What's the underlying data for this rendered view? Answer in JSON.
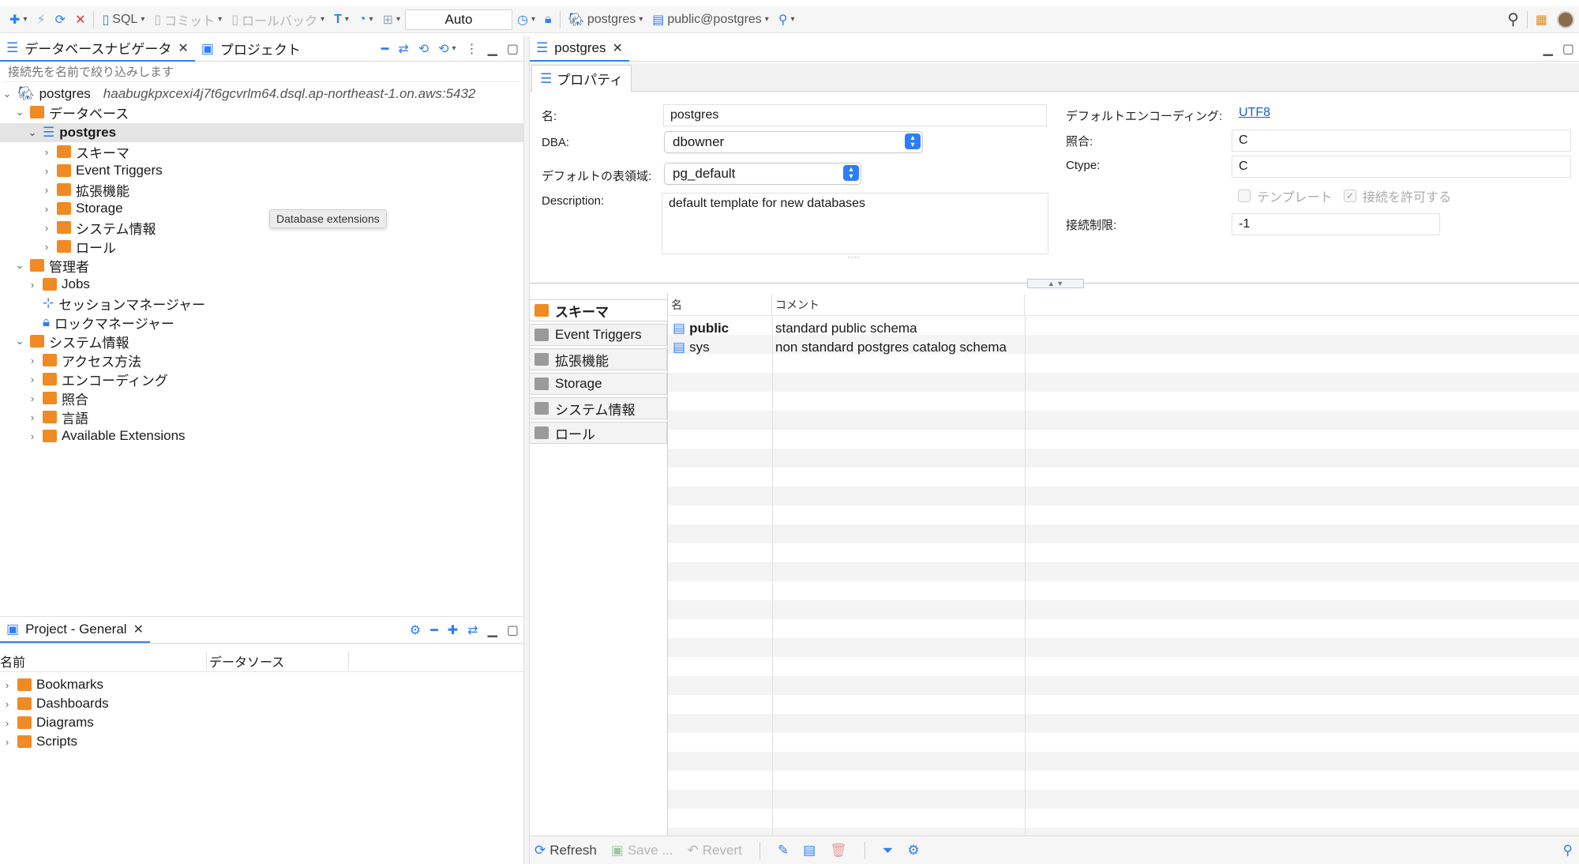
{
  "toolbar": {
    "sql_label": "SQL",
    "commit_label": "コミット",
    "rollback_label": "ロールバック",
    "mode_value": "Auto",
    "db_label": "postgres",
    "schema_label": "public@postgres"
  },
  "navigator": {
    "tab_db": "データベースナビゲータ",
    "tab_project": "プロジェクト",
    "filter_placeholder": "接続先を名前で絞り込みします",
    "conn_name": "postgres",
    "conn_host": "haabugkpxcexi4j7t6gcvrlm64.dsql.ap-northeast-1.on.aws:5432",
    "items": {
      "databases": "データベース",
      "db_postgres": "postgres",
      "schema": "スキーマ",
      "event_triggers": "Event Triggers",
      "extensions": "拡張機能",
      "storage": "Storage",
      "sysinfo": "システム情報",
      "roles": "ロール",
      "admin": "管理者",
      "jobs": "Jobs",
      "session_mgr": "セッションマネージャー",
      "lock_mgr": "ロックマネージャー",
      "sysinfo2": "システム情報",
      "access_methods": "アクセス方法",
      "encodings": "エンコーディング",
      "collations": "照合",
      "languages": "言語",
      "available_ext": "Available Extensions"
    },
    "tooltip": "Database extensions"
  },
  "project": {
    "title": "Project - General",
    "col_name": "名前",
    "col_ds": "データソース",
    "items": [
      "Bookmarks",
      "Dashboards",
      "Diagrams",
      "Scripts"
    ]
  },
  "editor": {
    "tab_title": "postgres",
    "subtab": "プロパティ",
    "props": {
      "name_label": "名:",
      "name_value": "postgres",
      "dba_label": "DBA:",
      "dba_value": "dbowner",
      "tablespace_label": "デフォルトの表領域:",
      "tablespace_value": "pg_default",
      "desc_label": "Description:",
      "desc_value": "default template for new databases",
      "enc_label": "デフォルトエンコーディング:",
      "enc_value": "UTF8",
      "collate_label": "照合:",
      "collate_value": "C",
      "ctype_label": "Ctype:",
      "ctype_value": "C",
      "template_label": "テンプレート",
      "allow_conn_label": "接続を許可する",
      "conn_limit_label": "接続制限:",
      "conn_limit_value": "-1"
    },
    "side_tabs": [
      "スキーマ",
      "Event Triggers",
      "拡張機能",
      "Storage",
      "システム情報",
      "ロール"
    ],
    "table": {
      "col_name": "名",
      "col_comment": "コメント",
      "rows": [
        {
          "name": "public",
          "comment": "standard public schema"
        },
        {
          "name": "sys",
          "comment": "non standard postgres catalog schema"
        }
      ]
    },
    "bottom": {
      "refresh": "Refresh",
      "save": "Save ...",
      "revert": "Revert"
    }
  },
  "colors": {
    "accent": "#2f7df6",
    "folder": "#f08a24",
    "selection": "#e4e4e4",
    "link": "#1a5fd0"
  }
}
